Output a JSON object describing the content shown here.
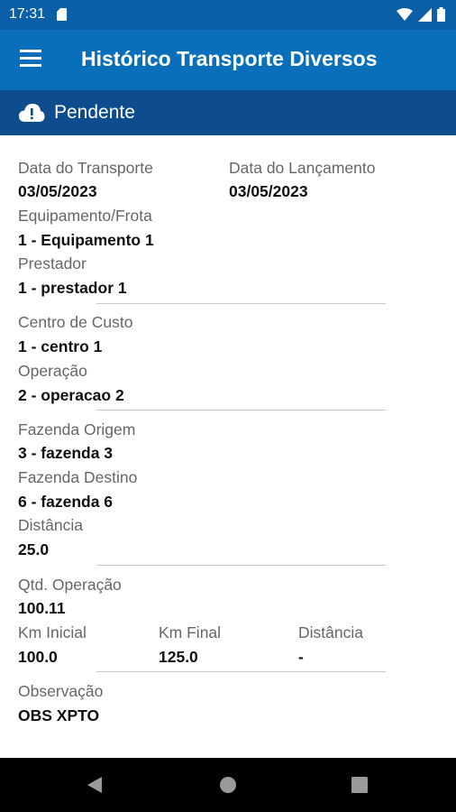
{
  "status_bar": {
    "time": "17:31"
  },
  "app_bar": {
    "title": "Histórico Transporte Diversos"
  },
  "state_bar": {
    "label": "Pendente"
  },
  "fields": {
    "data_transporte": {
      "label": "Data do Transporte",
      "value": "03/05/2023"
    },
    "data_lancamento": {
      "label": "Data do Lançamento",
      "value": "03/05/2023"
    },
    "equipamento": {
      "label": "Equipamento/Frota",
      "value": "1 - Equipamento 1"
    },
    "prestador": {
      "label": "Prestador",
      "value": "1 - prestador 1"
    },
    "centro_custo": {
      "label": "Centro de Custo",
      "value": "1 - centro 1"
    },
    "operacao": {
      "label": "Operação",
      "value": "2 - operacao 2"
    },
    "fazenda_origem": {
      "label": "Fazenda Origem",
      "value": "3 - fazenda 3"
    },
    "fazenda_destino": {
      "label": "Fazenda Destino",
      "value": "6 - fazenda 6"
    },
    "distancia": {
      "label": "Distância",
      "value": "25.0"
    },
    "qtd_operacao": {
      "label": "Qtd. Operação",
      "value": "100.11"
    },
    "km_inicial": {
      "label": "Km Inicial",
      "value": "100.0"
    },
    "km_final": {
      "label": "Km Final",
      "value": "125.0"
    },
    "distancia_km": {
      "label": "Distância",
      "value": "-"
    },
    "observacao": {
      "label": "Observação",
      "value": "OBS XPTO"
    }
  }
}
